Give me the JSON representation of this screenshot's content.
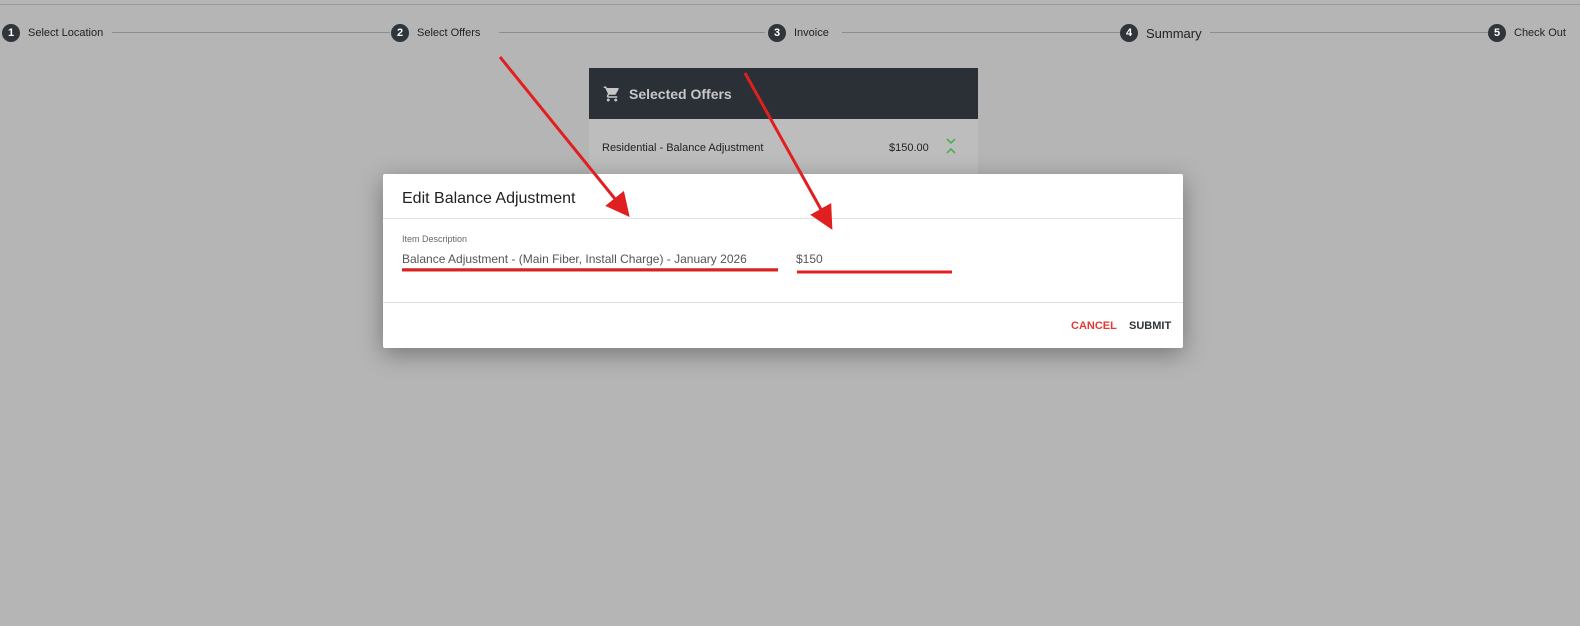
{
  "stepper": {
    "steps": [
      {
        "num": "1",
        "label": "Select Location"
      },
      {
        "num": "2",
        "label": "Select Offers"
      },
      {
        "num": "3",
        "label": "Invoice"
      },
      {
        "num": "4",
        "label": "Summary"
      },
      {
        "num": "5",
        "label": "Check Out"
      }
    ]
  },
  "card": {
    "title": "Selected Offers",
    "icon": "cart-icon",
    "rows": [
      {
        "description": "Residential - Balance Adjustment",
        "price": "$150.00",
        "icon": "chevron-collapse-icon"
      }
    ]
  },
  "modal": {
    "title": "Edit Balance Adjustment",
    "description_label": "Item Description",
    "description_value": "Balance Adjustment - (Main Fiber, Install Charge) - January 2026",
    "amount_value": "$150",
    "cancel_label": "CANCEL",
    "submit_label": "SUBMIT"
  },
  "colors": {
    "overlay": "#b5b5b5",
    "header_dark": "#2a3036",
    "accent_red": "#e53935",
    "chevron_green": "#4caf50"
  }
}
